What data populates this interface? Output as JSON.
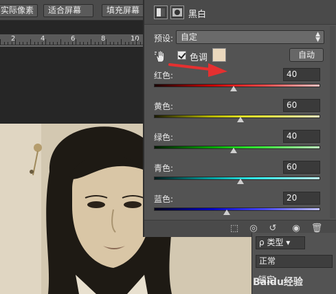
{
  "toolbar": {
    "actual_pixels_label": "实际像素",
    "fit_screen_label": "适合屏幕",
    "fill_screen_label": "填充屏幕"
  },
  "ruler": {
    "labels": [
      "2",
      "4",
      "6",
      "8",
      "10"
    ]
  },
  "panel": {
    "title": "黑白",
    "preset_label": "预设:",
    "preset_value": "自定",
    "tint_label": "色调",
    "tint_color": "#ead8bd",
    "auto_label": "自动",
    "channels": [
      {
        "label": "红色:",
        "value": "40",
        "level": 48,
        "gradient": "linear-gradient(90deg,#1a0000,#c00000,#ff4a4a,#ffc0c0)"
      },
      {
        "label": "黄色:",
        "value": "60",
        "level": 52,
        "gradient": "linear-gradient(90deg,#1a1a00,#b3b300,#ffff40,#ffffc0)"
      },
      {
        "label": "绿色:",
        "value": "40",
        "level": 48,
        "gradient": "linear-gradient(90deg,#001a00,#00a000,#40ff40,#c0ffc0)"
      },
      {
        "label": "青色:",
        "value": "60",
        "level": 52,
        "gradient": "linear-gradient(90deg,#001a1a,#00a0a0,#40ffff,#c0ffff)"
      },
      {
        "label": "蓝色:",
        "value": "20",
        "level": 44,
        "gradient": "linear-gradient(90deg,#00001a,#0000c0,#4a4aff,#c0c0ff)"
      }
    ]
  },
  "layers": {
    "kind_label": "类型",
    "blend_mode": "正常",
    "lock_label": "锁定"
  },
  "watermark": "Baidu经验"
}
